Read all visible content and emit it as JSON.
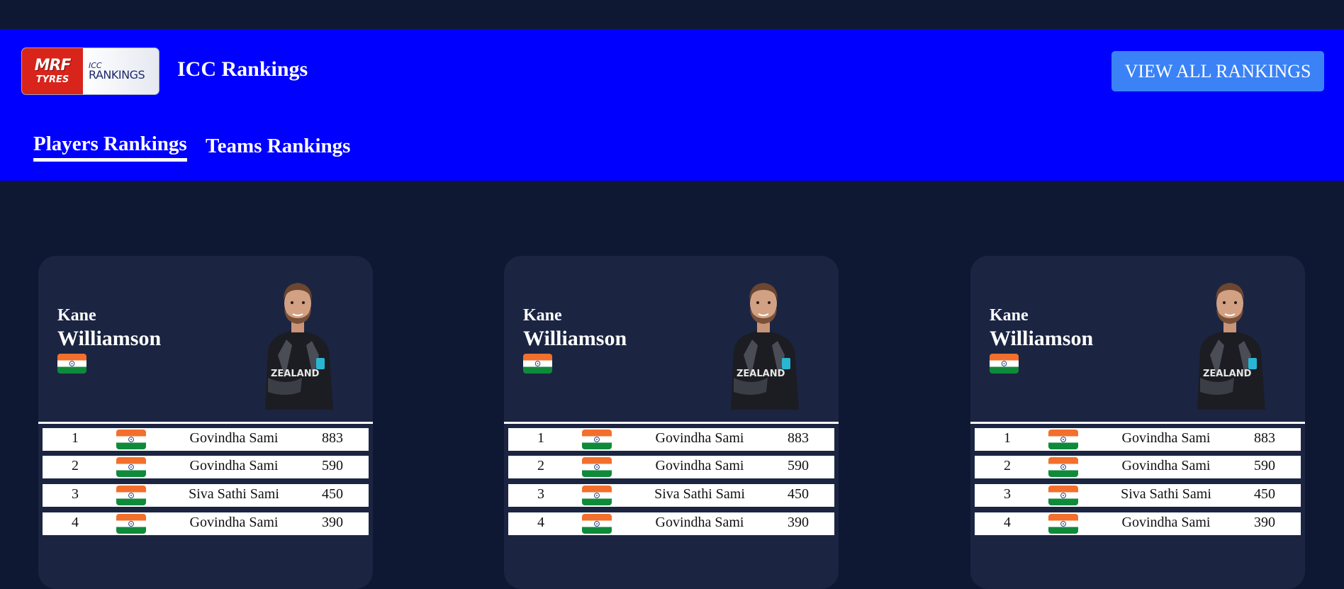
{
  "header": {
    "logo": {
      "brand_primary": "MRF",
      "brand_secondary": "TYRES",
      "partner_prefix": "ICC",
      "partner_word": "RANKINGS"
    },
    "title": "ICC Rankings",
    "view_all_label": "VIEW ALL RANKINGS",
    "tabs": [
      {
        "label": "Players Rankings",
        "active": true
      },
      {
        "label": "Teams Rankings",
        "active": false
      }
    ]
  },
  "colors": {
    "page_background": "#0f1833",
    "header_background": "#0000ff",
    "card_background": "#1b2542",
    "button_background": "#3a82f6",
    "flag_saffron": "#f26f2c",
    "flag_green": "#0f8a3a",
    "chakra_blue": "#0a2a7c"
  },
  "cards": [
    {
      "first_name": "Kane",
      "last_name": "Williamson",
      "flag_icon": "india-flag-icon",
      "photo_icon": "player-photo",
      "rows": [
        {
          "rank": "1",
          "name": "Govindha Sami",
          "points": "883"
        },
        {
          "rank": "2",
          "name": "Govindha Sami",
          "points": "590"
        },
        {
          "rank": "3",
          "name": "Siva Sathi Sami",
          "points": "450"
        },
        {
          "rank": "4",
          "name": "Govindha Sami",
          "points": "390"
        }
      ]
    },
    {
      "first_name": "Kane",
      "last_name": "Williamson",
      "flag_icon": "india-flag-icon",
      "photo_icon": "player-photo",
      "rows": [
        {
          "rank": "1",
          "name": "Govindha Sami",
          "points": "883"
        },
        {
          "rank": "2",
          "name": "Govindha Sami",
          "points": "590"
        },
        {
          "rank": "3",
          "name": "Siva Sathi Sami",
          "points": "450"
        },
        {
          "rank": "4",
          "name": "Govindha Sami",
          "points": "390"
        }
      ]
    },
    {
      "first_name": "Kane",
      "last_name": "Williamson",
      "flag_icon": "india-flag-icon",
      "photo_icon": "player-photo",
      "rows": [
        {
          "rank": "1",
          "name": "Govindha Sami",
          "points": "883"
        },
        {
          "rank": "2",
          "name": "Govindha Sami",
          "points": "590"
        },
        {
          "rank": "3",
          "name": "Siva Sathi Sami",
          "points": "450"
        },
        {
          "rank": "4",
          "name": "Govindha Sami",
          "points": "390"
        }
      ]
    }
  ]
}
